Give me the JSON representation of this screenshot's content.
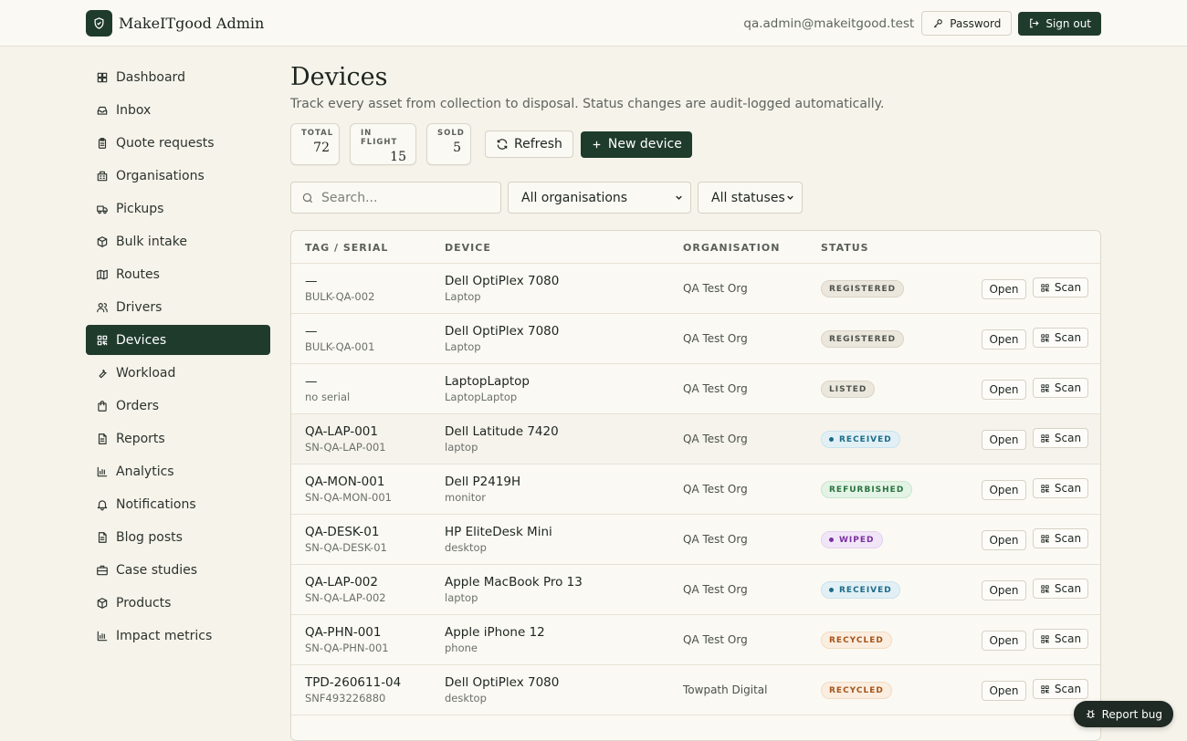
{
  "header": {
    "app_name": "MakeITgood Admin",
    "user_email": "qa.admin@makeitgood.test",
    "password_label": "Password",
    "signout_label": "Sign out"
  },
  "sidebar": {
    "items": [
      {
        "label": "Dashboard",
        "icon": "dashboard-icon"
      },
      {
        "label": "Inbox",
        "icon": "inbox-icon"
      },
      {
        "label": "Quote requests",
        "icon": "clipboard-icon"
      },
      {
        "label": "Organisations",
        "icon": "building-icon"
      },
      {
        "label": "Pickups",
        "icon": "truck-icon"
      },
      {
        "label": "Bulk intake",
        "icon": "package-icon"
      },
      {
        "label": "Routes",
        "icon": "map-icon"
      },
      {
        "label": "Drivers",
        "icon": "users-icon"
      },
      {
        "label": "Devices",
        "icon": "qr-code-icon",
        "active": true
      },
      {
        "label": "Workload",
        "icon": "wrench-icon"
      },
      {
        "label": "Orders",
        "icon": "shopping-bag-icon"
      },
      {
        "label": "Reports",
        "icon": "file-text-icon"
      },
      {
        "label": "Analytics",
        "icon": "bar-chart-icon"
      },
      {
        "label": "Notifications",
        "icon": "bell-icon"
      },
      {
        "label": "Blog posts",
        "icon": "file-text-icon"
      },
      {
        "label": "Case studies",
        "icon": "briefcase-icon"
      },
      {
        "label": "Products",
        "icon": "package-icon"
      },
      {
        "label": "Impact metrics",
        "icon": "bar-chart-icon"
      }
    ]
  },
  "main": {
    "title": "Devices",
    "subtitle": "Track every asset from collection to disposal. Status changes are audit-logged automatically.",
    "stats": [
      {
        "label": "TOTAL",
        "value": "72"
      },
      {
        "label": "IN FLIGHT",
        "value": "15"
      },
      {
        "label": "SOLD",
        "value": "5"
      }
    ],
    "refresh_label": "Refresh",
    "new_device_label": "New device",
    "search_placeholder": "Search...",
    "org_filter": "All organisations",
    "status_filter": "All statuses",
    "table": {
      "headers": [
        "TAG / SERIAL",
        "DEVICE",
        "ORGANISATION",
        "STATUS"
      ],
      "open_label": "Open",
      "scan_label": "Scan",
      "rows": [
        {
          "tag": "—",
          "serial": "BULK-QA-002",
          "device": "Dell OptiPlex 7080",
          "type": "Laptop",
          "org": "QA Test Org",
          "status": "REGISTERED",
          "status_key": "registered"
        },
        {
          "tag": "—",
          "serial": "BULK-QA-001",
          "device": "Dell OptiPlex 7080",
          "type": "Laptop",
          "org": "QA Test Org",
          "status": "REGISTERED",
          "status_key": "registered"
        },
        {
          "tag": "—",
          "serial": "no serial",
          "device": "LaptopLaptop",
          "type": "LaptopLaptop",
          "org": "QA Test Org",
          "status": "LISTED",
          "status_key": "listed"
        },
        {
          "tag": "QA-LAP-001",
          "serial": "SN-QA-LAP-001",
          "device": "Dell Latitude 7420",
          "type": "laptop",
          "org": "QA Test Org",
          "status": "RECEIVED",
          "status_key": "received"
        },
        {
          "tag": "QA-MON-001",
          "serial": "SN-QA-MON-001",
          "device": "Dell P2419H",
          "type": "monitor",
          "org": "QA Test Org",
          "status": "REFURBISHED",
          "status_key": "refurbished"
        },
        {
          "tag": "QA-DESK-01",
          "serial": "SN-QA-DESK-01",
          "device": "HP EliteDesk Mini",
          "type": "desktop",
          "org": "QA Test Org",
          "status": "WIPED",
          "status_key": "wiped"
        },
        {
          "tag": "QA-LAP-002",
          "serial": "SN-QA-LAP-002",
          "device": "Apple MacBook Pro 13",
          "type": "laptop",
          "org": "QA Test Org",
          "status": "RECEIVED",
          "status_key": "received"
        },
        {
          "tag": "QA-PHN-001",
          "serial": "SN-QA-PHN-001",
          "device": "Apple iPhone 12",
          "type": "phone",
          "org": "QA Test Org",
          "status": "RECYCLED",
          "status_key": "recycled"
        },
        {
          "tag": "TPD-260611-04",
          "serial": "SNF493226880",
          "device": "Dell OptiPlex 7080",
          "type": "desktop",
          "org": "Towpath Digital",
          "status": "RECYCLED",
          "status_key": "recycled"
        }
      ]
    }
  },
  "report_bug_label": "Report bug",
  "colors": {
    "brand": "#1f3b2c",
    "background": "#f6f3ea"
  }
}
